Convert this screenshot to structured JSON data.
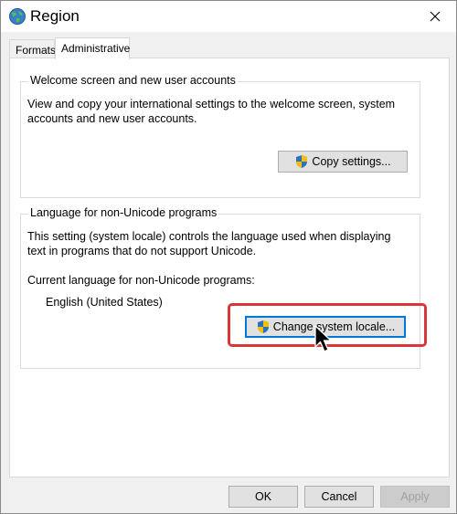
{
  "window": {
    "title": "Region"
  },
  "tabs": [
    {
      "label": "Formats",
      "active": false
    },
    {
      "label": "Administrative",
      "active": true
    }
  ],
  "welcome_group": {
    "title": "Welcome screen and new user accounts",
    "description_line1": "View and copy your international settings to the welcome screen, system",
    "description_line2": "accounts and new user accounts.",
    "copy_button": "Copy settings..."
  },
  "locale_group": {
    "title": "Language for non-Unicode programs",
    "description_line1": "This setting (system locale) controls the language used when displaying",
    "description_line2": "text in programs that do not support Unicode.",
    "current_label": "Current language for non-Unicode programs:",
    "current_value": "English (United States)",
    "change_button": "Change system locale..."
  },
  "footer": {
    "ok": "OK",
    "cancel": "Cancel",
    "apply": "Apply"
  },
  "colors": {
    "highlight": "#d9363e",
    "accent": "#0078d7"
  }
}
